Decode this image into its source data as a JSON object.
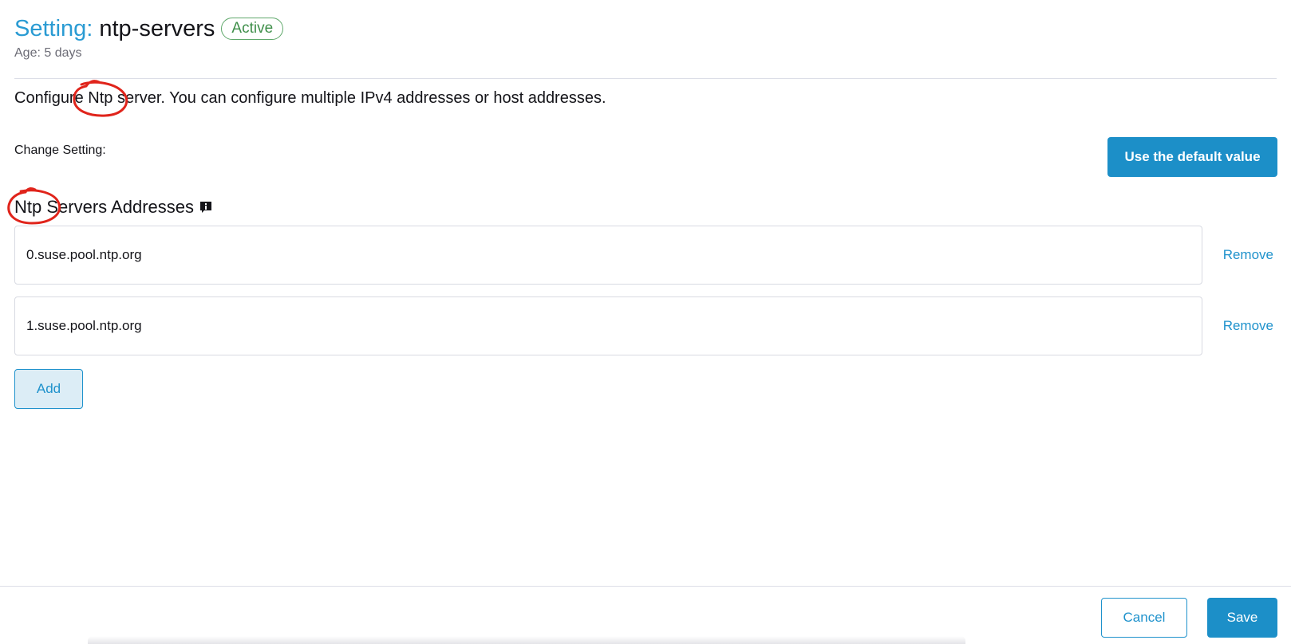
{
  "header": {
    "title_prefix": "Setting:",
    "title_name": "ntp-servers",
    "status_badge": "Active",
    "age": "Age: 5 days"
  },
  "description": "Configure Ntp server. You can configure multiple IPv4 addresses or host addresses.",
  "change_setting": {
    "label": "Change Setting:",
    "default_button": "Use the default value"
  },
  "section": {
    "heading": "Ntp Servers Addresses",
    "icon": "info-icon",
    "entries": [
      {
        "value": "0.suse.pool.ntp.org",
        "remove_label": "Remove"
      },
      {
        "value": "1.suse.pool.ntp.org",
        "remove_label": "Remove"
      }
    ],
    "add_label": "Add"
  },
  "footer": {
    "cancel_label": "Cancel",
    "save_label": "Save"
  },
  "colors": {
    "accent": "#1c8fc8",
    "active_badge": "#3f8f4a",
    "annotation": "#e0241b"
  }
}
